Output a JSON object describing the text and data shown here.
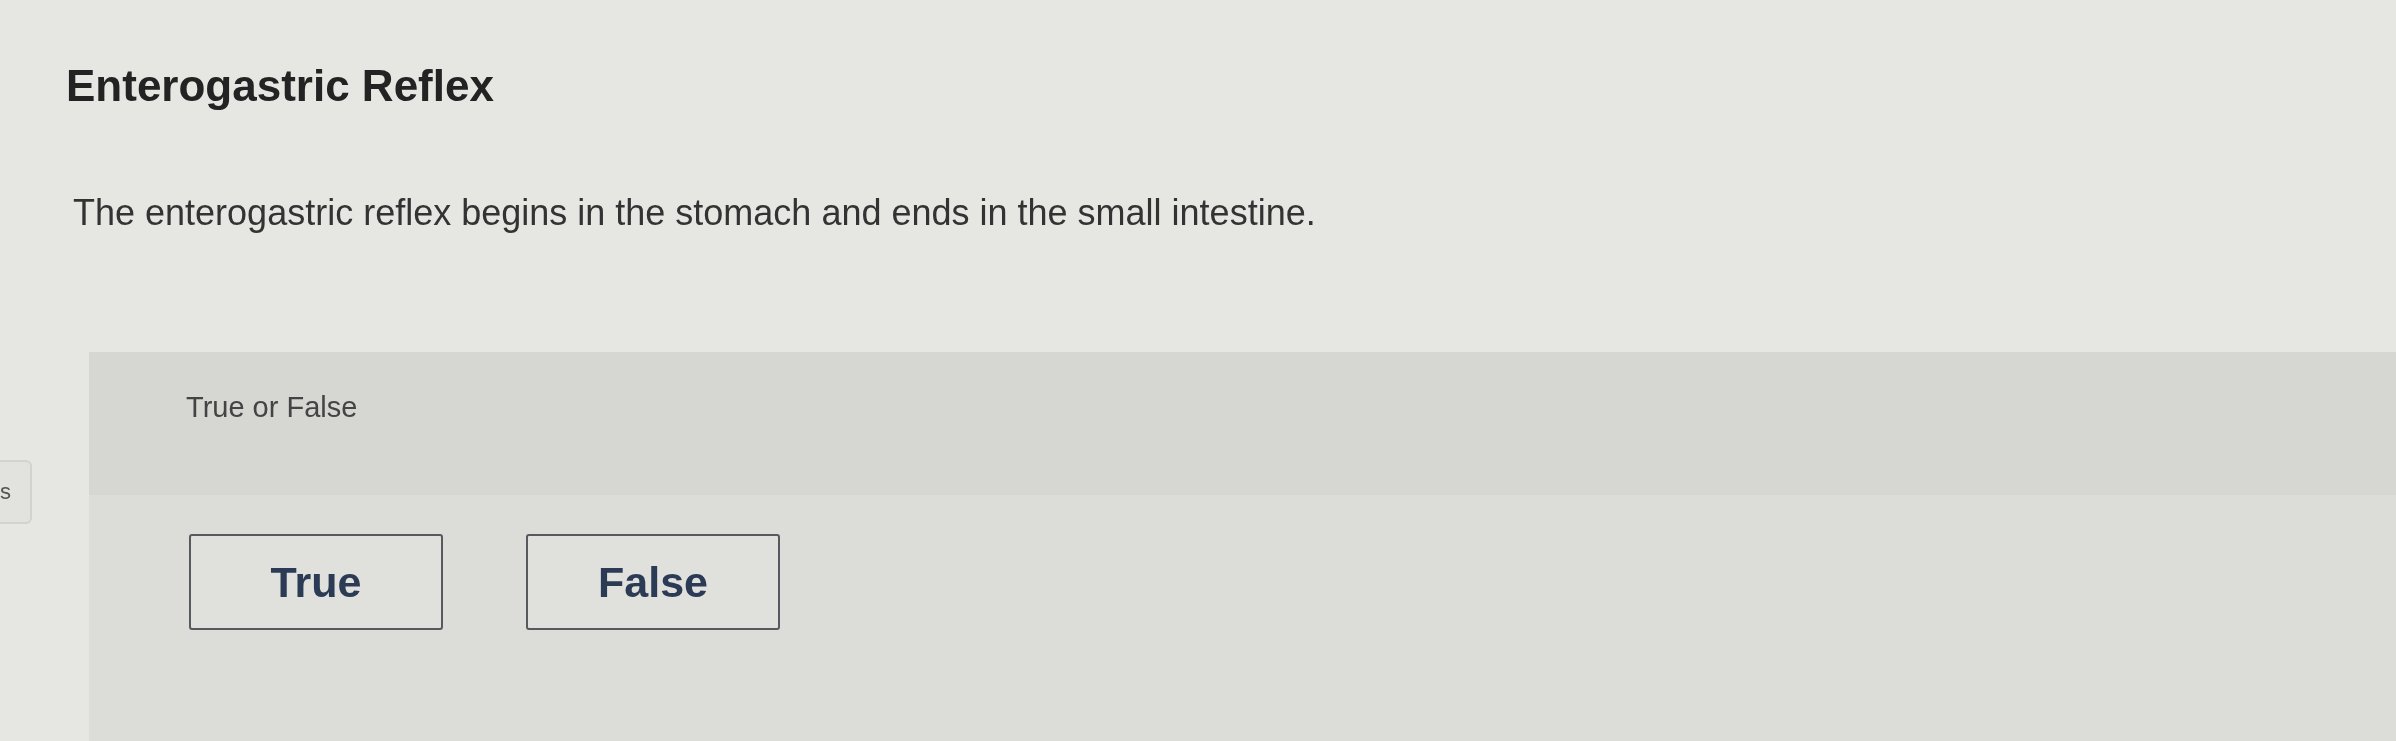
{
  "page": {
    "title": "Enterogastric Reflex",
    "prompt": "The enterogastric reflex begins in the stomach and ends in the small intestine."
  },
  "side_tab": {
    "label": "s"
  },
  "question": {
    "instruction": "True or False",
    "options": [
      {
        "label": "True",
        "selected": false
      },
      {
        "label": "False",
        "selected": false
      }
    ]
  }
}
